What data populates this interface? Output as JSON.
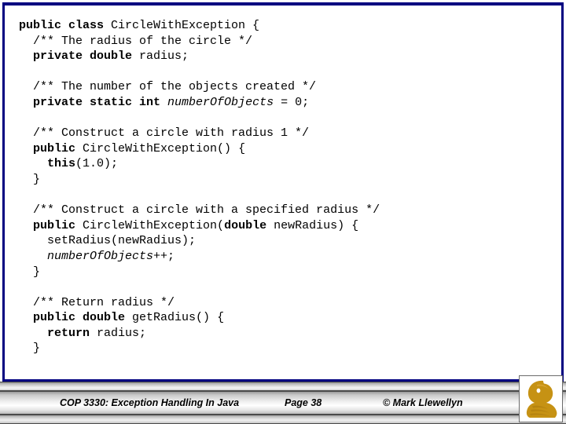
{
  "slide": {
    "border_color": "#000080",
    "background": "#ffffff",
    "code_color": "#000000"
  },
  "code": {
    "language": "java",
    "lines": [
      [
        {
          "t": "public class ",
          "s": "b"
        },
        {
          "t": "CircleWithException {",
          "s": "n"
        }
      ],
      [
        {
          "t": "  /** The radius of the circle */",
          "s": "n"
        }
      ],
      [
        {
          "t": "  ",
          "s": "n"
        },
        {
          "t": "private double ",
          "s": "b"
        },
        {
          "t": "radius;",
          "s": "n"
        }
      ],
      [],
      [
        {
          "t": "  /** The number of the objects created */",
          "s": "n"
        }
      ],
      [
        {
          "t": "  ",
          "s": "n"
        },
        {
          "t": "private static int ",
          "s": "b"
        },
        {
          "t": "numberOfObjects",
          "s": "i"
        },
        {
          "t": " = 0;",
          "s": "n"
        }
      ],
      [],
      [
        {
          "t": "  /** Construct a circle with radius 1 */",
          "s": "n"
        }
      ],
      [
        {
          "t": "  ",
          "s": "n"
        },
        {
          "t": "public ",
          "s": "b"
        },
        {
          "t": "CircleWithException() {",
          "s": "n"
        }
      ],
      [
        {
          "t": "    ",
          "s": "n"
        },
        {
          "t": "this",
          "s": "b"
        },
        {
          "t": "(1.0);",
          "s": "n"
        }
      ],
      [
        {
          "t": "  }",
          "s": "n"
        }
      ],
      [],
      [
        {
          "t": "  /** Construct a circle with a specified radius */",
          "s": "n"
        }
      ],
      [
        {
          "t": "  ",
          "s": "n"
        },
        {
          "t": "public ",
          "s": "b"
        },
        {
          "t": "CircleWithException(",
          "s": "n"
        },
        {
          "t": "double ",
          "s": "b"
        },
        {
          "t": "newRadius) {",
          "s": "n"
        }
      ],
      [
        {
          "t": "    setRadius(newRadius);",
          "s": "n"
        }
      ],
      [
        {
          "t": "    ",
          "s": "n"
        },
        {
          "t": "numberOfObjects",
          "s": "i"
        },
        {
          "t": "++;",
          "s": "n"
        }
      ],
      [
        {
          "t": "  }",
          "s": "n"
        }
      ],
      [],
      [
        {
          "t": "  /** Return radius */",
          "s": "n"
        }
      ],
      [
        {
          "t": "  ",
          "s": "n"
        },
        {
          "t": "public double ",
          "s": "b"
        },
        {
          "t": "getRadius() {",
          "s": "n"
        }
      ],
      [
        {
          "t": "    ",
          "s": "n"
        },
        {
          "t": "return ",
          "s": "b"
        },
        {
          "t": "radius;",
          "s": "n"
        }
      ],
      [
        {
          "t": "  }",
          "s": "n"
        }
      ]
    ]
  },
  "footer": {
    "course": "COP 3330:  Exception Handling In Java",
    "page": "Page 38",
    "copyright": "© Mark Llewellyn",
    "logo_name": "ucf-pegasus-logo",
    "logo_color": "#C69214"
  }
}
